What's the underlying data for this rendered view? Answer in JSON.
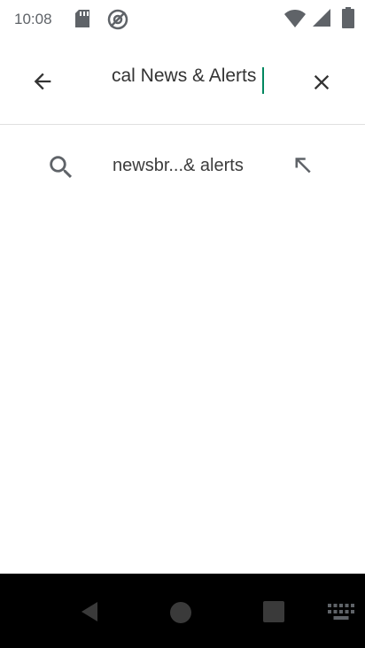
{
  "status_bar": {
    "time": "10:08",
    "icons": [
      "sd-card-icon",
      "sync-icon",
      "wifi-icon",
      "signal-icon",
      "battery-icon"
    ]
  },
  "search": {
    "query": "cal News & Alerts",
    "back_icon": "arrow-back-icon",
    "clear_icon": "close-icon",
    "accent_color": "#01875f"
  },
  "suggestions": [
    {
      "label": "newsbr...& alerts",
      "icon": "search-icon",
      "action_icon": "arrow-up-left-icon"
    }
  ],
  "nav_bar": {
    "buttons": [
      "nav-back-icon",
      "nav-home-icon",
      "nav-recents-icon",
      "keyboard-icon"
    ]
  }
}
